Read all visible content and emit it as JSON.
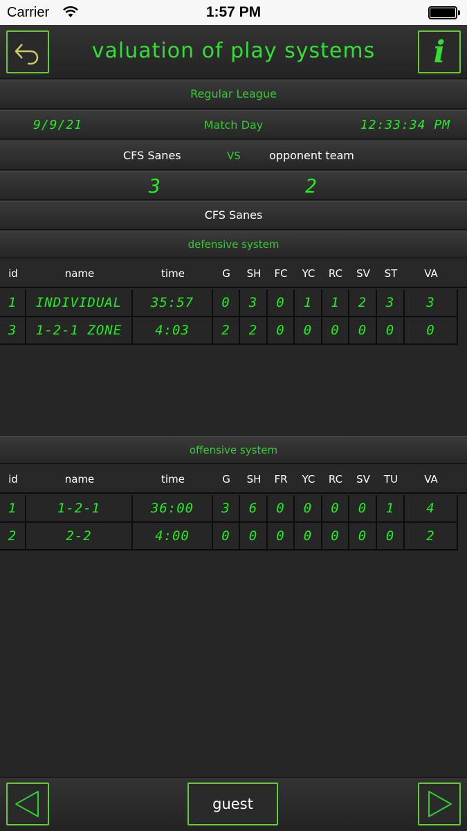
{
  "status_bar": {
    "carrier": "Carrier",
    "time": "1:57 PM"
  },
  "header": {
    "title": "valuation of play systems",
    "back_icon": "undo-arrow-icon",
    "info_icon": "info-icon",
    "info_glyph": "i"
  },
  "match": {
    "league": "Regular League",
    "date": "9/9/21",
    "label": "Match Day",
    "time": "12:33:34 PM",
    "home_team": "CFS Sanes",
    "vs": "VS",
    "away_team": "opponent team",
    "home_score": "3",
    "away_score": "2",
    "selected_team": "CFS Sanes"
  },
  "defensive": {
    "title": "defensive system",
    "headers": [
      "id",
      "name",
      "time",
      "G",
      "SH",
      "FC",
      "YC",
      "RC",
      "SV",
      "ST",
      "VA"
    ],
    "rows": [
      [
        "1",
        "INDIVIDUAL",
        "35:57",
        "0",
        "3",
        "0",
        "1",
        "1",
        "2",
        "3",
        "3"
      ],
      [
        "3",
        "1-2-1 ZONE",
        "4:03",
        "2",
        "2",
        "0",
        "0",
        "0",
        "0",
        "0",
        "0"
      ]
    ]
  },
  "offensive": {
    "title": "offensive system",
    "headers": [
      "id",
      "name",
      "time",
      "G",
      "SH",
      "FR",
      "YC",
      "RC",
      "SV",
      "TU",
      "VA"
    ],
    "rows": [
      [
        "1",
        "1-2-1",
        "36:00",
        "3",
        "6",
        "0",
        "0",
        "0",
        "0",
        "1",
        "4"
      ],
      [
        "2",
        "2-2",
        "4:00",
        "0",
        "0",
        "0",
        "0",
        "0",
        "0",
        "0",
        "2"
      ]
    ]
  },
  "footer": {
    "prev_icon": "triangle-left-icon",
    "next_icon": "triangle-right-icon",
    "guest_label": "guest"
  },
  "colors": {
    "accent": "#33cc33",
    "lcd": "#22ee22",
    "button_border": "#66cc33",
    "background": "#262626"
  }
}
